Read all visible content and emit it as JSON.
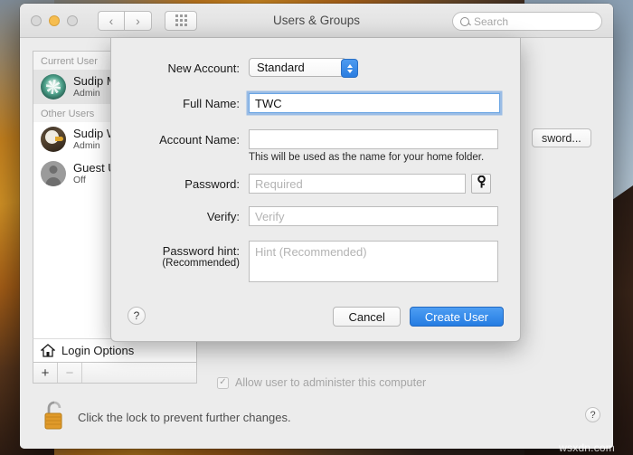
{
  "window": {
    "title": "Users & Groups",
    "search_placeholder": "Search",
    "nav_back": "‹",
    "nav_forward": "›",
    "grid_button": "show-all-preferences"
  },
  "sidebar": {
    "groups": [
      {
        "header": "Current User",
        "users": [
          {
            "name": "Sudip M",
            "role": "Admin",
            "avatar": "flower-avatar",
            "selected": true
          }
        ]
      },
      {
        "header": "Other Users",
        "users": [
          {
            "name": "Sudip W",
            "role": "Admin",
            "avatar": "eagle-avatar",
            "selected": false
          },
          {
            "name": "Guest U",
            "role": "Off",
            "avatar": "guest-avatar",
            "selected": false
          }
        ]
      }
    ],
    "login_options": "Login Options",
    "add_button": "+",
    "remove_button": "−"
  },
  "main": {
    "change_password_button": "sword...",
    "admin_checkbox_label": "Allow user to administer this computer",
    "admin_checkbox_checked": true,
    "admin_checkbox_enabled": false
  },
  "lockbar": {
    "text": "Click the lock to prevent further changes.",
    "lock_state": "unlocked",
    "help_button": "?"
  },
  "sheet": {
    "fields": {
      "new_account_label": "New Account:",
      "new_account_value": "Standard",
      "full_name_label": "Full Name:",
      "full_name_value": "TWC",
      "account_name_label": "Account Name:",
      "account_name_value": "",
      "account_name_note": "This will be used as the name for your home folder.",
      "password_label": "Password:",
      "password_placeholder": "Required",
      "verify_label": "Verify:",
      "verify_placeholder": "Verify",
      "hint_label": "Password hint:",
      "hint_sublabel": "(Recommended)",
      "hint_placeholder": "Hint (Recommended)"
    },
    "buttons": {
      "help": "?",
      "cancel": "Cancel",
      "create": "Create User"
    },
    "key_button": "key-icon"
  },
  "colors": {
    "accent_blue": "#2b7de0",
    "window_bg": "#ececec",
    "lock_gold": "#e09a2a"
  },
  "watermark": "wsxdn.com"
}
